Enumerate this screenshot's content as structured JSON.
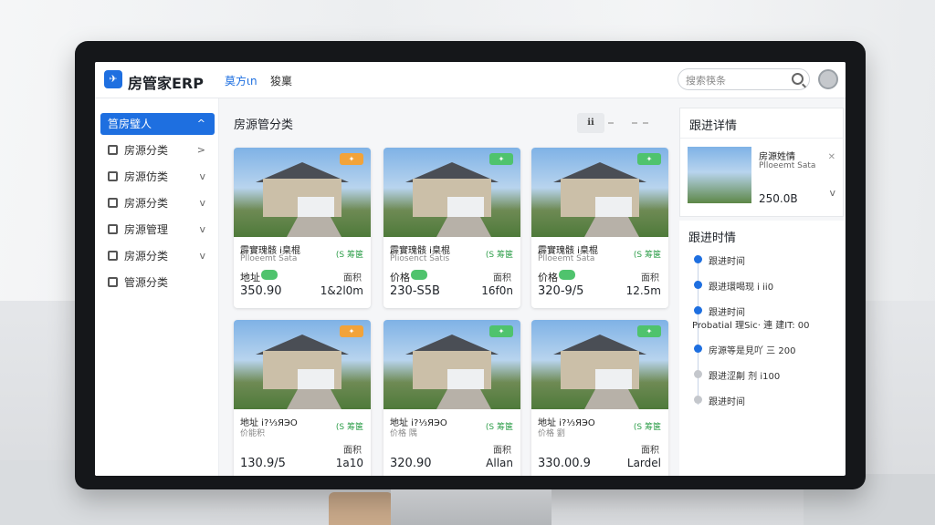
{
  "app": {
    "logo_glyph": "✈",
    "brand": "房管家ERP"
  },
  "header": {
    "nav": [
      "莫方ιn",
      "狻稟"
    ],
    "search_placeholder": "搜索筷条"
  },
  "sidebar": {
    "items": [
      {
        "label": "筥房璧人",
        "chev": "^",
        "active": true
      },
      {
        "label": "房源分类",
        "chev": ">"
      },
      {
        "label": "房源仿类",
        "chev": "v"
      },
      {
        "label": "房源分类",
        "chev": "v"
      },
      {
        "label": "房源管理",
        "chev": "v"
      },
      {
        "label": "房源分类",
        "chev": "v"
      },
      {
        "label": "管源分类",
        "chev": ""
      }
    ]
  },
  "main": {
    "title": "房源管分类",
    "tools_label": "ℹℹ"
  },
  "cards": [
    {
      "title": "霹實瑰骸 ⅰ臬棍",
      "sub": "Plloeemt Sata",
      "badge": "(S 筹箧",
      "lab1": "地址",
      "lab2": "面积",
      "price": "350.90",
      "area": "1&2l0m",
      "tag_color": "#f2a33a"
    },
    {
      "title": "霹實瑰骸 ⅰ臬棍",
      "sub": "Pliosenct Satis",
      "badge": "(S 筹箧",
      "lab1": "价格",
      "lab2": "面积",
      "price": "230-S5B",
      "area": "16f0n",
      "tag_color": "#4fc36d"
    },
    {
      "title": "霹實瑰骸 ⅰ臬棍",
      "sub": "Plloeemt Sata",
      "badge": "(S 筹箧",
      "lab1": "价格",
      "lab2": "面积",
      "price": "320-9/5",
      "area": "12.5m",
      "tag_color": "#4fc36d"
    },
    {
      "title": "地址 ⅰ?⅓ЯЭO",
      "sub": "价能积",
      "badge": "(S 筹箧",
      "lab1": "",
      "lab2": "面积",
      "price": "130.9/5",
      "area": "1a10",
      "tag_color": "#f2a33a"
    },
    {
      "title": "地址 ⅰ?⅓ЯЭO",
      "sub": "价格 隅",
      "badge": "(S 筹箧",
      "lab1": "",
      "lab2": "面积",
      "price": "320.90",
      "area": "Allan",
      "tag_color": "#4fc36d"
    },
    {
      "title": "地址 ⅰ?⅓ЯЭO",
      "sub": "价格 劉",
      "badge": "(S 筹箧",
      "lab1": "",
      "lab2": "面积",
      "price": "330.00.9",
      "area": "Lardel",
      "tag_color": "#4fc36d"
    }
  ],
  "detail": {
    "title": "跟进详情",
    "name": "房源姓情",
    "sub": "Plloeemt Sata",
    "price": "250.0B",
    "close": "✕",
    "chev": "v"
  },
  "timeline": {
    "title": "跟进时情",
    "items": [
      {
        "text": "跟进时间",
        "color": "#1e6fe0"
      },
      {
        "text": "跟进環喝现 ⅰ ⅰⅰ0",
        "color": "#1e6fe0"
      },
      {
        "text": "跟进时间",
        "color": "#1e6fe0"
      },
      {
        "text": "Probatial 理Sic· 連 建IT: 00",
        "color": "#1e6fe0"
      },
      {
        "text": "房源等是見吖 三 200",
        "color": "#1e6fe0"
      },
      {
        "text": "跟进涩劓 剂 ⅰ100",
        "color": "#c4c7cc"
      },
      {
        "text": "跟进时间",
        "color": "#c4c7cc"
      }
    ]
  }
}
